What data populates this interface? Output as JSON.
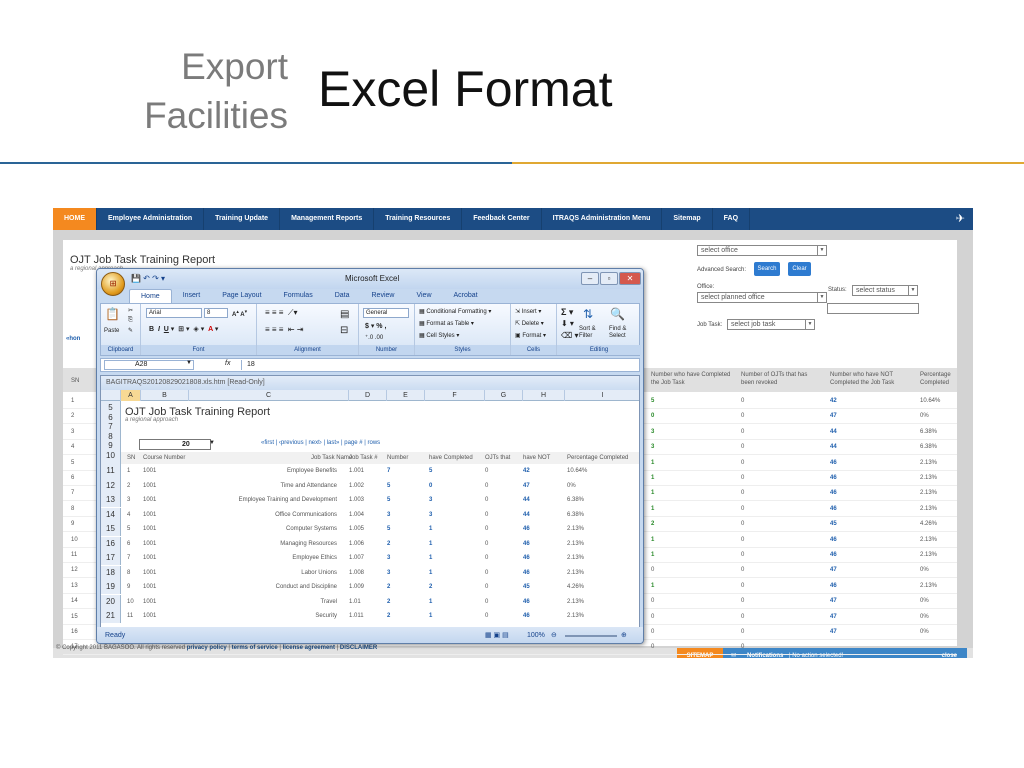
{
  "slide": {
    "subtitle_line1": "Export",
    "subtitle_line2": "Facilities",
    "title": "Excel Format"
  },
  "nav": {
    "home": "HOME",
    "items": [
      "Employee Administration",
      "Training Update",
      "Management Reports",
      "Training Resources",
      "Feedback Center",
      "ITRAQS Administration Menu",
      "Sitemap",
      "FAQ"
    ]
  },
  "report": {
    "title": "OJT Job Task Training Report",
    "subtitle": "a regional approach",
    "office_select": "select office",
    "advanced_search_label": "Advanced Search:",
    "search_button": "Search",
    "clear_button": "Clear",
    "office_label": "Office:",
    "planned_office_select": "select planned office",
    "status_label": "Status:",
    "status_select": "select status",
    "job_task_label": "Job Task:",
    "job_task_select": "select job task",
    "sn_header": "SN",
    "headers": [
      "Number who have Completed the Job Task",
      "Number of OJTs that has been revoked",
      "Number who have NOT Completed the Job Task",
      "Percentage Completed"
    ],
    "sn": [
      "1",
      "2",
      "3",
      "4",
      "5",
      "6",
      "7",
      "8",
      "9",
      "10",
      "11",
      "12",
      "13",
      "14",
      "15",
      "16",
      "17"
    ],
    "completed": [
      "5",
      "0",
      "3",
      "3",
      "1",
      "1",
      "1",
      "1",
      "2",
      "1",
      "1",
      "0",
      "1",
      "0",
      "0",
      "0",
      "0"
    ],
    "revoked": [
      "0",
      "0",
      "0",
      "0",
      "0",
      "0",
      "0",
      "0",
      "0",
      "0",
      "0",
      "0",
      "0",
      "0",
      "0",
      "0",
      "0"
    ],
    "not_completed": [
      "42",
      "47",
      "44",
      "44",
      "46",
      "46",
      "46",
      "46",
      "45",
      "46",
      "46",
      "47",
      "46",
      "47",
      "47",
      "47",
      ""
    ],
    "percent": [
      "10.64%",
      "0%",
      "6.38%",
      "6.38%",
      "2.13%",
      "2.13%",
      "2.13%",
      "2.13%",
      "4.26%",
      "2.13%",
      "2.13%",
      "0%",
      "2.13%",
      "0%",
      "0%",
      "0%",
      ""
    ],
    "sitemap": "SITEMAP",
    "notifications": "Notifications",
    "notifications_text": "| No action selected!",
    "close": "close",
    "copyright": "© Copyright 2011 BAGASOO. All rights reserved",
    "footer_links": [
      "privacy policy",
      "terms of service",
      "license agreement",
      "DISCLAIMER"
    ],
    "hon": "«hon"
  },
  "excel": {
    "title": "Microsoft Excel",
    "tabs": [
      "Home",
      "Insert",
      "Page Layout",
      "Formulas",
      "Data",
      "Review",
      "View",
      "Acrobat"
    ],
    "font_name": "Arial",
    "font_size": "8",
    "number_format": "General",
    "groups": [
      "Clipboard",
      "Font",
      "Alignment",
      "Number",
      "Styles",
      "Cells",
      "Editing"
    ],
    "paste": "Paste",
    "cond_format": "Conditional Formatting",
    "format_table": "Format as Table",
    "cell_styles": "Cell Styles",
    "insert": "Insert",
    "delete": "Delete",
    "format": "Format",
    "sort_filter": "Sort & Filter",
    "find_select": "Find & Select",
    "name_box": "A28",
    "fx": "fx",
    "formula_value": "18",
    "workbook_title": "BAGITRAQS20120829021808.xls.htm  [Read-Only]",
    "columns": [
      "A",
      "B",
      "C",
      "D",
      "E",
      "F",
      "G",
      "H",
      "I"
    ],
    "sheet_title": "OJT Job Task Training Report",
    "sheet_subtitle": "a regional approach",
    "pager_value": "20",
    "pager_text": "«first  |  ‹previous  |  next›  |  last»  |  page #  |  rows",
    "header_row": [
      "SN",
      "Course Number",
      "Job Task Name",
      "Job Task #",
      "Number",
      "have Completed",
      "OJTs that",
      "have NOT",
      "Percentage Completed"
    ],
    "row_numbers": [
      "5",
      "6",
      "7",
      "8",
      "9",
      "10",
      "11",
      "12",
      "13",
      "14",
      "15",
      "16",
      "17",
      "18",
      "19",
      "20",
      "21"
    ],
    "rows": [
      [
        "1",
        "1001",
        "Employee Benefits",
        "1.001",
        "7",
        "5",
        "0",
        "42",
        "10.64%"
      ],
      [
        "2",
        "1001",
        "Time and Attendance",
        "1.002",
        "5",
        "0",
        "0",
        "47",
        "0%"
      ],
      [
        "3",
        "1001",
        "Employee Training and Development",
        "1.003",
        "5",
        "3",
        "0",
        "44",
        "6.38%"
      ],
      [
        "4",
        "1001",
        "Office Communications",
        "1.004",
        "3",
        "3",
        "0",
        "44",
        "6.38%"
      ],
      [
        "5",
        "1001",
        "Computer Systems",
        "1.005",
        "5",
        "1",
        "0",
        "46",
        "2.13%"
      ],
      [
        "6",
        "1001",
        "Managing Resources",
        "1.006",
        "2",
        "1",
        "0",
        "46",
        "2.13%"
      ],
      [
        "7",
        "1001",
        "Employee Ethics",
        "1.007",
        "3",
        "1",
        "0",
        "46",
        "2.13%"
      ],
      [
        "8",
        "1001",
        "Labor Unions",
        "1.008",
        "3",
        "1",
        "0",
        "46",
        "2.13%"
      ],
      [
        "9",
        "1001",
        "Conduct and Discipline",
        "1.009",
        "2",
        "2",
        "0",
        "45",
        "4.26%"
      ],
      [
        "10",
        "1001",
        "Travel",
        "1.01",
        "2",
        "1",
        "0",
        "46",
        "2.13%"
      ],
      [
        "11",
        "1001",
        "Security",
        "1.011",
        "2",
        "1",
        "0",
        "46",
        "2.13%"
      ]
    ],
    "status_ready": "Ready",
    "zoom": "100%"
  },
  "colors": {
    "nav": "#1c4c84",
    "home": "#f4891f",
    "accent_blue": "#2a6496",
    "accent_gold": "#e0a833"
  }
}
